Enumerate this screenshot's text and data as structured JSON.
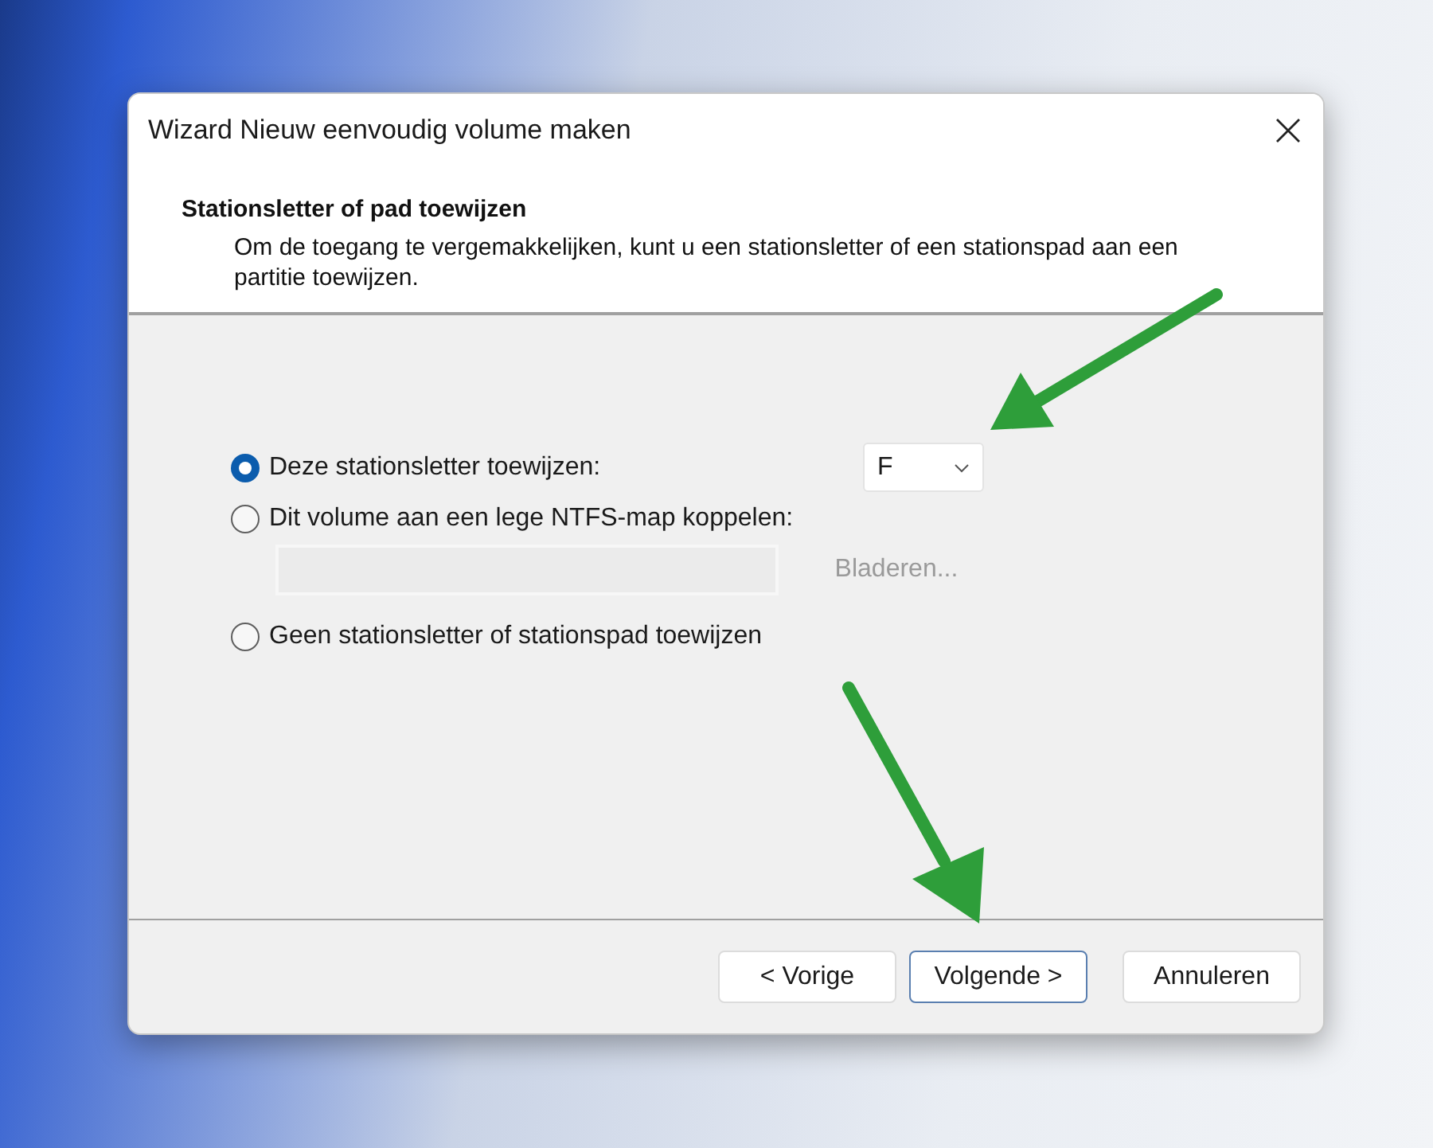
{
  "window": {
    "title": "Wizard Nieuw eenvoudig volume maken"
  },
  "header": {
    "title": "Stationsletter of pad toewijzen",
    "description": "Om de toegang te vergemakkelijken, kunt u een stationsletter of een stationspad aan een partitie toewijzen."
  },
  "options": [
    {
      "kind": "letter",
      "label": "Deze stationsletter toewijzen:",
      "selected": true
    },
    {
      "kind": "folder",
      "label": "Dit volume aan een lege NTFS-map koppelen:",
      "selected": false
    },
    {
      "kind": "none",
      "label": "Geen stationsletter of stationspad toewijzen",
      "selected": false
    }
  ],
  "drive_letter": {
    "value": "F"
  },
  "folder_path": {
    "disabled": true
  },
  "browse_button": {
    "label": "Bladeren...",
    "disabled": true
  },
  "buttons": [
    {
      "label": "< Vorige",
      "focused": false
    },
    {
      "label": "Volgende >",
      "focused": true
    },
    {
      "label": "Annuleren",
      "focused": false
    }
  ]
}
